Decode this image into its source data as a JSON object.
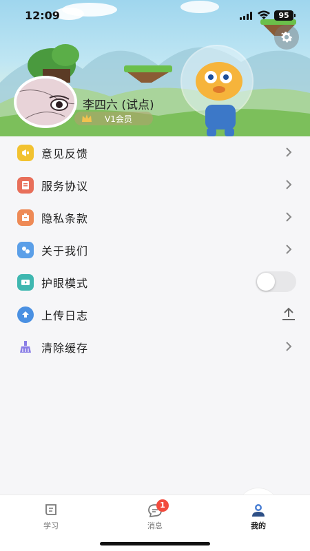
{
  "status_bar": {
    "time": "12:09",
    "battery": "95"
  },
  "profile": {
    "name": "李四六 (试点)",
    "member_level": "V1会员"
  },
  "menu": [
    {
      "label": "意见反馈",
      "icon": "feedback-icon",
      "color": "#f2c230",
      "action": "chevron"
    },
    {
      "label": "服务协议",
      "icon": "agreement-icon",
      "color": "#e86f5a",
      "action": "chevron"
    },
    {
      "label": "隐私条款",
      "icon": "privacy-icon",
      "color": "#ee8a56",
      "action": "chevron"
    },
    {
      "label": "关于我们",
      "icon": "about-icon",
      "color": "#5b9fe8",
      "action": "chevron"
    },
    {
      "label": "护眼模式",
      "icon": "eye-care-icon",
      "color": "#3fb7b0",
      "action": "toggle",
      "enabled": false
    },
    {
      "label": "上传日志",
      "icon": "upload-log-icon",
      "color": "#4a90e2",
      "action": "upload"
    },
    {
      "label": "清除缓存",
      "icon": "clear-cache-icon",
      "color": "#8a7ee6",
      "action": "chevron"
    }
  ],
  "tabbar": {
    "tabs": [
      {
        "label": "学习",
        "icon": "study-icon"
      },
      {
        "label": "消息",
        "icon": "message-icon",
        "badge": "1"
      },
      {
        "label": "我的",
        "icon": "profile-icon",
        "active": true
      }
    ]
  },
  "colors": {
    "accent": "#4a90e2",
    "badge": "#f24b3d",
    "background": "#f6f6f8"
  }
}
